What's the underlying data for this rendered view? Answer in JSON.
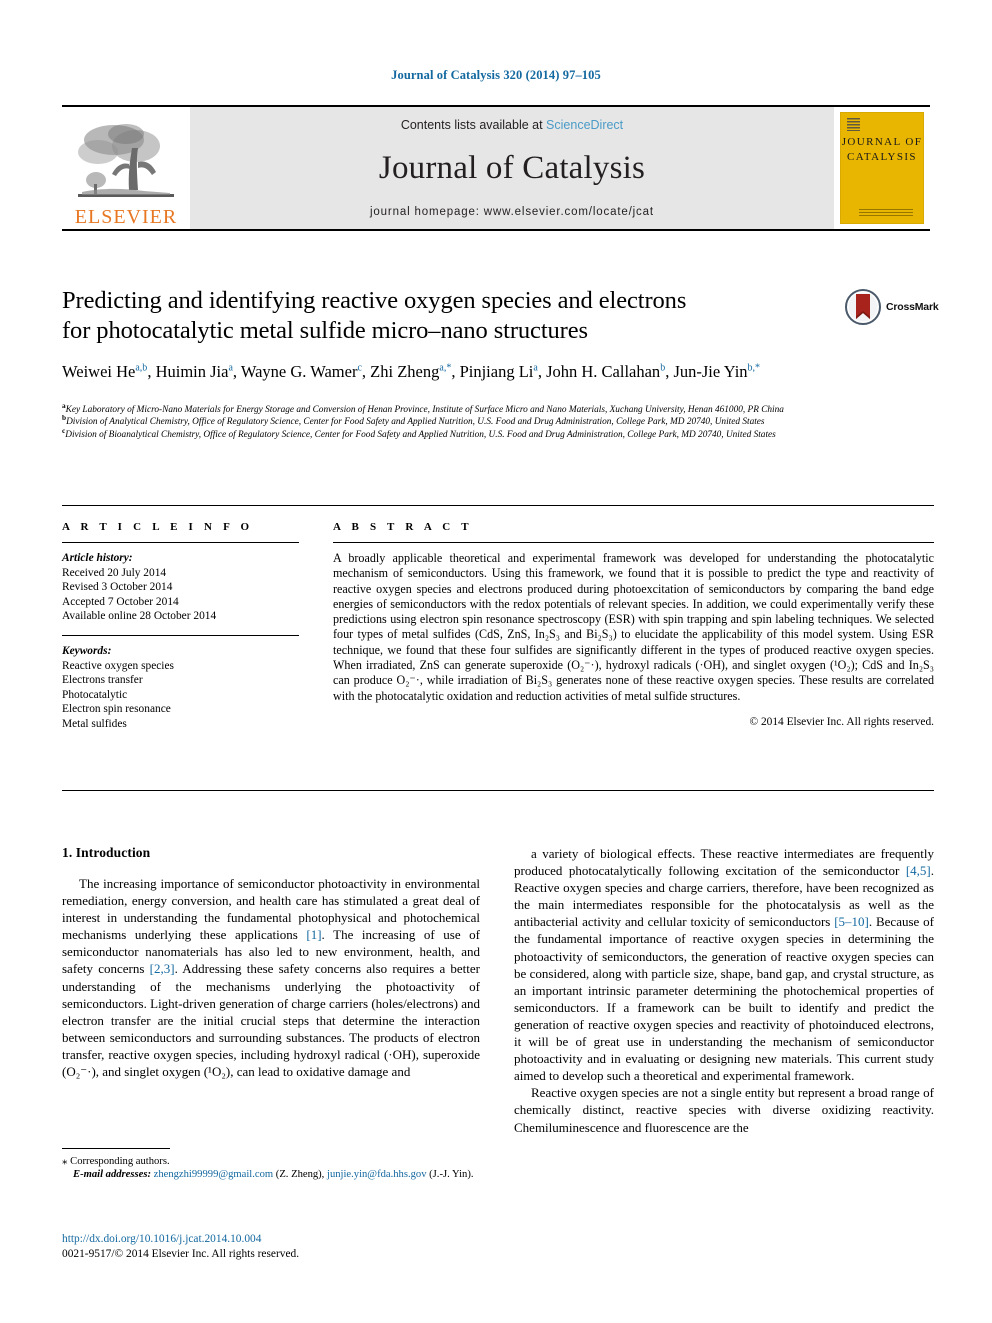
{
  "running_head": "Journal of Catalysis 320 (2014) 97–105",
  "masthead": {
    "publisher_logo_name": "elsevier-logo",
    "publisher_wordmark": "ELSEVIER",
    "contents_prefix": "Contents lists available at ",
    "contents_link": "ScienceDirect",
    "journal_name": "Journal of Catalysis",
    "homepage": "journal homepage: www.elsevier.com/locate/jcat",
    "cover": {
      "line1": "JOURNAL OF",
      "line2": "CATALYSIS"
    }
  },
  "article": {
    "title_line1": "Predicting and identifying reactive oxygen species and electrons",
    "title_line2": "for photocatalytic metal sulfide micro–nano structures",
    "crossmark_label": "CrossMark",
    "authors": [
      {
        "name": "Weiwei He",
        "sup": "a,b",
        "sep": ", "
      },
      {
        "name": "Huimin Jia",
        "sup": "a",
        "sep": ", "
      },
      {
        "name": "Wayne G. Wamer",
        "sup": "c",
        "sep": ", "
      },
      {
        "name": "Zhi Zheng",
        "sup": "a,*",
        "sep": ", "
      },
      {
        "name": "Pinjiang Li",
        "sup": "a",
        "sep": ", "
      },
      {
        "name": "John H. Callahan",
        "sup": "b",
        "sep": ", "
      },
      {
        "name": "Jun-Jie Yin",
        "sup": "b,*",
        "sep": ""
      }
    ],
    "affiliations": [
      {
        "sup": "a",
        "text": "Key Laboratory of Micro-Nano Materials for Energy Storage and Conversion of Henan Province, Institute of Surface Micro and Nano Materials, Xuchang University, Henan 461000, PR China"
      },
      {
        "sup": "b",
        "text": "Division of Analytical Chemistry, Office of Regulatory Science, Center for Food Safety and Applied Nutrition, U.S. Food and Drug Administration, College Park, MD 20740, United States"
      },
      {
        "sup": "c",
        "text": "Division of Bioanalytical Chemistry, Office of Regulatory Science, Center for Food Safety and Applied Nutrition, U.S. Food and Drug Administration, College Park, MD 20740, United States"
      }
    ]
  },
  "article_info": {
    "heading": "A R T I C L E     I N F O",
    "history_label": "Article history:",
    "history": [
      "Received 20 July 2014",
      "Revised 3 October 2014",
      "Accepted 7 October 2014",
      "Available online 28 October 2014"
    ],
    "keywords_label": "Keywords:",
    "keywords": [
      "Reactive oxygen species",
      "Electrons transfer",
      "Photocatalytic",
      "Electron spin resonance",
      "Metal sulfides"
    ]
  },
  "abstract": {
    "heading": "A B S T R A C T",
    "text": "A broadly applicable theoretical and experimental framework was developed for understanding the photocatalytic mechanism of semiconductors. Using this framework, we found that it is possible to predict the type and reactivity of reactive oxygen species and electrons produced during photoexcitation of semiconductors by comparing the band edge energies of semiconductors with the redox potentials of relevant species. In addition, we could experimentally verify these predictions using electron spin resonance spectroscopy (ESR) with spin trapping and spin labeling techniques. We selected four types of metal sulfides (CdS, ZnS, In₂S₃ and Bi₂S₃) to elucidate the applicability of this model system. Using ESR technique, we found that these four sulfides are significantly different in the types of produced reactive oxygen species. When irradiated, ZnS can generate superoxide (O₂⁻·), hydroxyl radicals (·OH), and singlet oxygen (¹O₂); CdS and In₂S₃ can produce O₂⁻·, while irradiation of Bi₂S₃ generates none of these reactive oxygen species. These results are correlated with the photocatalytic oxidation and reduction activities of metal sulfide structures.",
    "copyright": "© 2014 Elsevier Inc. All rights reserved."
  },
  "body": {
    "section_heading": "1. Introduction",
    "left_paragraphs": [
      "The increasing importance of semiconductor photoactivity in environmental remediation, energy conversion, and health care has stimulated a great deal of interest in understanding the fundamental photophysical and photochemical mechanisms underlying these applications [1]. The increasing of use of semiconductor nanomaterials has also led to new environment, health, and safety concerns [2,3]. Addressing these safety concerns also requires a better understanding of the mechanisms underlying the photoactivity of semiconductors. Light-driven generation of charge carriers (holes/electrons) and electron transfer are the initial crucial steps that determine the interaction between semiconductors and surrounding substances. The products of electron transfer, reactive oxygen species, including hydroxyl radical (·OH), superoxide (O₂⁻·), and singlet oxygen (¹O₂), can lead to oxidative damage and"
    ],
    "right_paragraphs": [
      "a variety of biological effects. These reactive intermediates are frequently produced photocatalytically following excitation of the semiconductor [4,5]. Reactive oxygen species and charge carriers, therefore, have been recognized as the main intermediates responsible for the photocatalysis as well as the antibacterial activity and cellular toxicity of semiconductors [5–10]. Because of the fundamental importance of reactive oxygen species in determining the photoactivity of semiconductors, the generation of reactive oxygen species can be considered, along with particle size, shape, band gap, and crystal structure, as an important intrinsic parameter determining the photochemical properties of semiconductors. If a framework can be built to identify and predict the generation of reactive oxygen species and reactivity of photoinduced electrons, it will be of great use in understanding the mechanism of semiconductor photoactivity and in evaluating or designing new materials. This current study aimed to develop such a theoretical and experimental framework.",
      "Reactive oxygen species are not a single entity but represent a broad range of chemically distinct, reactive species with diverse oxidizing reactivity. Chemiluminescence and fluorescence are the"
    ]
  },
  "footnote": {
    "star": "⁎",
    "corresponding": "Corresponding authors.",
    "email_label": "E-mail addresses:",
    "email1": "zhengzhi99999@gmail.com",
    "email1_owner": "(Z. Zheng),",
    "email2": "junjie.yin@fda.hhs.gov",
    "email2_owner": "(J.-J. Yin)."
  },
  "footer": {
    "doi": "http://dx.doi.org/10.1016/j.jcat.2014.10.004",
    "issn": "0021-9517/© 2014 Elsevier Inc. All rights reserved."
  },
  "colors": {
    "link_blue": "#1368a0",
    "sciencedirect_blue": "#4a9bc7",
    "elsevier_orange": "#e87722",
    "cover_yellow": "#e8b500",
    "masthead_grey": "#e6e6e6"
  }
}
